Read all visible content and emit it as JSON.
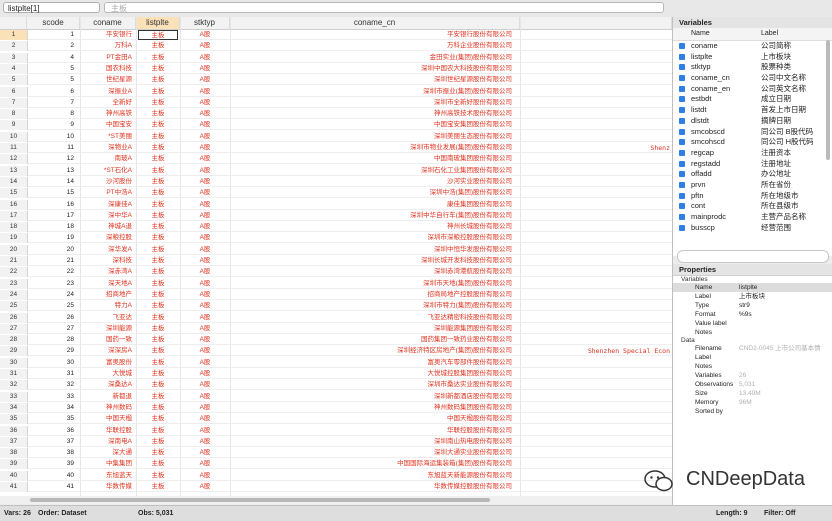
{
  "toolbar": {
    "cell_ref": "listplte[1]",
    "cell_value": "主板"
  },
  "columns": [
    "scode",
    "coname",
    "listplte",
    "stktyp",
    "coname_cn"
  ],
  "rows": [
    {
      "n": "1",
      "scode": "1",
      "coname": "平安银行",
      "listplte": "主板",
      "stktyp": "A股",
      "coname_cn": "平安银行股份有限公司",
      "coname_en": ""
    },
    {
      "n": "2",
      "scode": "2",
      "coname": "万科A",
      "listplte": "主板",
      "stktyp": "A股",
      "coname_cn": "万科企业股份有限公司",
      "coname_en": ""
    },
    {
      "n": "3",
      "scode": "4",
      "coname": "PT金田A",
      "listplte": "主板",
      "stktyp": "A股",
      "coname_cn": "金田实业(集团)股份有限公司",
      "coname_en": ""
    },
    {
      "n": "4",
      "scode": "5",
      "coname": "国农科技",
      "listplte": "主板",
      "stktyp": "A股",
      "coname_cn": "深圳中国农大科技股份有限公司",
      "coname_en": ""
    },
    {
      "n": "5",
      "scode": "5",
      "coname": "世纪星源",
      "listplte": "主板",
      "stktyp": "A股",
      "coname_cn": "深圳世纪星源股份有限公司",
      "coname_en": ""
    },
    {
      "n": "6",
      "scode": "6",
      "coname": "深振业A",
      "listplte": "主板",
      "stktyp": "A股",
      "coname_cn": "深圳市振业(集团)股份有限公司",
      "coname_en": ""
    },
    {
      "n": "7",
      "scode": "7",
      "coname": "全新好",
      "listplte": "主板",
      "stktyp": "A股",
      "coname_cn": "深圳市全新好股份有限公司",
      "coname_en": ""
    },
    {
      "n": "8",
      "scode": "8",
      "coname": "神州高铁",
      "listplte": "主板",
      "stktyp": "A股",
      "coname_cn": "神州高铁技术股份有限公司",
      "coname_en": ""
    },
    {
      "n": "9",
      "scode": "9",
      "coname": "中国宝安",
      "listplte": "主板",
      "stktyp": "A股",
      "coname_cn": "中国宝安集团股份有限公司",
      "coname_en": ""
    },
    {
      "n": "10",
      "scode": "10",
      "coname": "*ST美丽",
      "listplte": "主板",
      "stktyp": "A股",
      "coname_cn": "深圳美丽生态股份有限公司",
      "coname_en": ""
    },
    {
      "n": "11",
      "scode": "11",
      "coname": "深物业A",
      "listplte": "主板",
      "stktyp": "A股",
      "coname_cn": "深圳市物业发展(集团)股份有限公司",
      "coname_en": "Shenz"
    },
    {
      "n": "12",
      "scode": "12",
      "coname": "南玻A",
      "listplte": "主板",
      "stktyp": "A股",
      "coname_cn": "中国南玻集团股份有限公司",
      "coname_en": ""
    },
    {
      "n": "13",
      "scode": "13",
      "coname": "*ST石化A",
      "listplte": "主板",
      "stktyp": "A股",
      "coname_cn": "深圳石化工业集团股份有限公司",
      "coname_en": ""
    },
    {
      "n": "14",
      "scode": "14",
      "coname": "沙河股份",
      "listplte": "主板",
      "stktyp": "A股",
      "coname_cn": "沙河实业股份有限公司",
      "coname_en": ""
    },
    {
      "n": "15",
      "scode": "15",
      "coname": "PT中浩A",
      "listplte": "主板",
      "stktyp": "A股",
      "coname_cn": "深圳中浩(集团)股份有限公司",
      "coname_en": ""
    },
    {
      "n": "16",
      "scode": "16",
      "coname": "深康佳A",
      "listplte": "主板",
      "stktyp": "A股",
      "coname_cn": "康佳集团股份有限公司",
      "coname_en": ""
    },
    {
      "n": "17",
      "scode": "17",
      "coname": "深中华A",
      "listplte": "主板",
      "stktyp": "A股",
      "coname_cn": "深圳中华自行车(集团)股份有限公司",
      "coname_en": ""
    },
    {
      "n": "18",
      "scode": "18",
      "coname": "神城A退",
      "listplte": "主板",
      "stktyp": "A股",
      "coname_cn": "神州长城股份有限公司",
      "coname_en": ""
    },
    {
      "n": "19",
      "scode": "19",
      "coname": "深粮控股",
      "listplte": "主板",
      "stktyp": "A股",
      "coname_cn": "深圳市深粮控股股份有限公司",
      "coname_en": ""
    },
    {
      "n": "20",
      "scode": "20",
      "coname": "深华发A",
      "listplte": "主板",
      "stktyp": "A股",
      "coname_cn": "深圳中恒华发股份有限公司",
      "coname_en": ""
    },
    {
      "n": "21",
      "scode": "21",
      "coname": "深科技",
      "listplte": "主板",
      "stktyp": "A股",
      "coname_cn": "深圳长城开发科技股份有限公司",
      "coname_en": ""
    },
    {
      "n": "22",
      "scode": "22",
      "coname": "深赤湾A",
      "listplte": "主板",
      "stktyp": "A股",
      "coname_cn": "深圳赤湾港航股份有限公司",
      "coname_en": ""
    },
    {
      "n": "23",
      "scode": "23",
      "coname": "深天地A",
      "listplte": "主板",
      "stktyp": "A股",
      "coname_cn": "深圳市天地(集团)股份有限公司",
      "coname_en": ""
    },
    {
      "n": "24",
      "scode": "24",
      "coname": "招商地产",
      "listplte": "主板",
      "stktyp": "A股",
      "coname_cn": "招商局地产控股股份有限公司",
      "coname_en": ""
    },
    {
      "n": "25",
      "scode": "25",
      "coname": "特力A",
      "listplte": "主板",
      "stktyp": "A股",
      "coname_cn": "深圳市特力(集团)股份有限公司",
      "coname_en": ""
    },
    {
      "n": "26",
      "scode": "26",
      "coname": "飞亚达",
      "listplte": "主板",
      "stktyp": "A股",
      "coname_cn": "飞亚达精密科技股份有限公司",
      "coname_en": ""
    },
    {
      "n": "27",
      "scode": "27",
      "coname": "深圳能源",
      "listplte": "主板",
      "stktyp": "A股",
      "coname_cn": "深圳能源集团股份有限公司",
      "coname_en": ""
    },
    {
      "n": "28",
      "scode": "28",
      "coname": "国药一致",
      "listplte": "主板",
      "stktyp": "A股",
      "coname_cn": "国药集团一致药业股份有限公司",
      "coname_en": ""
    },
    {
      "n": "29",
      "scode": "29",
      "coname": "深深房A",
      "listplte": "主板",
      "stktyp": "A股",
      "coname_cn": "深圳经济特区房地产(集团)股份有限公司",
      "coname_en": "Shenzhen Special Econ"
    },
    {
      "n": "30",
      "scode": "30",
      "coname": "富奥股份",
      "listplte": "主板",
      "stktyp": "A股",
      "coname_cn": "富奥汽车零部件股份有限公司",
      "coname_en": ""
    },
    {
      "n": "31",
      "scode": "31",
      "coname": "大悦城",
      "listplte": "主板",
      "stktyp": "A股",
      "coname_cn": "大悦城控股集团股份有限公司",
      "coname_en": ""
    },
    {
      "n": "32",
      "scode": "32",
      "coname": "深桑达A",
      "listplte": "主板",
      "stktyp": "A股",
      "coname_cn": "深圳市桑达实业股份有限公司",
      "coname_en": ""
    },
    {
      "n": "33",
      "scode": "33",
      "coname": "新都退",
      "listplte": "主板",
      "stktyp": "A股",
      "coname_cn": "深圳新都酒店股份有限公司",
      "coname_en": ""
    },
    {
      "n": "34",
      "scode": "34",
      "coname": "神州数码",
      "listplte": "主板",
      "stktyp": "A股",
      "coname_cn": "神州数码集团股份有限公司",
      "coname_en": ""
    },
    {
      "n": "35",
      "scode": "35",
      "coname": "中国天楹",
      "listplte": "主板",
      "stktyp": "A股",
      "coname_cn": "中国天楹股份有限公司",
      "coname_en": ""
    },
    {
      "n": "36",
      "scode": "36",
      "coname": "华联控股",
      "listplte": "主板",
      "stktyp": "A股",
      "coname_cn": "华联控股股份有限公司",
      "coname_en": ""
    },
    {
      "n": "37",
      "scode": "37",
      "coname": "深南电A",
      "listplte": "主板",
      "stktyp": "A股",
      "coname_cn": "深圳南山热电股份有限公司",
      "coname_en": ""
    },
    {
      "n": "38",
      "scode": "38",
      "coname": "深大通",
      "listplte": "主板",
      "stktyp": "A股",
      "coname_cn": "深圳大通实业股份有限公司",
      "coname_en": ""
    },
    {
      "n": "39",
      "scode": "39",
      "coname": "中集集团",
      "listplte": "主板",
      "stktyp": "A股",
      "coname_cn": "中国国际海运集装箱(集团)股份有限公司",
      "coname_en": ""
    },
    {
      "n": "40",
      "scode": "40",
      "coname": "东旭蓝天",
      "listplte": "主板",
      "stktyp": "A股",
      "coname_cn": "东旭蓝天新能源股份有限公司",
      "coname_en": ""
    },
    {
      "n": "41",
      "scode": "41",
      "coname": "华数传媒",
      "listplte": "主板",
      "stktyp": "A股",
      "coname_cn": "华数传媒控股股份有限公司",
      "coname_en": ""
    }
  ],
  "variables_panel": {
    "title": "Variables",
    "col_name": "Name",
    "col_label": "Label",
    "items": [
      {
        "name": "coname",
        "label": "公司简称"
      },
      {
        "name": "listplte",
        "label": "上市板块"
      },
      {
        "name": "stktyp",
        "label": "股票种类"
      },
      {
        "name": "coname_cn",
        "label": "公司中文名称"
      },
      {
        "name": "coname_en",
        "label": "公司英文名称"
      },
      {
        "name": "estbdt",
        "label": "成立日期"
      },
      {
        "name": "listdt",
        "label": "首发上市日期"
      },
      {
        "name": "dlstdt",
        "label": "摘牌日期"
      },
      {
        "name": "smcobscd",
        "label": "同公司 B股代码"
      },
      {
        "name": "smcohscd",
        "label": "同公司 H股代码"
      },
      {
        "name": "regcap",
        "label": "注册资本"
      },
      {
        "name": "regstadd",
        "label": "注册地址"
      },
      {
        "name": "offadd",
        "label": "办公地址"
      },
      {
        "name": "prvn",
        "label": "所在省份"
      },
      {
        "name": "pftn",
        "label": "所在地级市"
      },
      {
        "name": "cont",
        "label": "所在县级市"
      },
      {
        "name": "mainprodc",
        "label": "主营产品名称"
      },
      {
        "name": "busscp",
        "label": "经营范围"
      }
    ]
  },
  "properties_panel": {
    "title": "Properties",
    "group_variables": "Variables",
    "group_data": "Data",
    "var_props": [
      {
        "k": "Name",
        "v": "listplte"
      },
      {
        "k": "Label",
        "v": "上市板块"
      },
      {
        "k": "Type",
        "v": "str9"
      },
      {
        "k": "Format",
        "v": "%9s"
      },
      {
        "k": "Value label",
        "v": ""
      },
      {
        "k": "Notes",
        "v": ""
      }
    ],
    "data_props": [
      {
        "k": "Filename",
        "v": "CND2-0045 上市公司基本情"
      },
      {
        "k": "Label",
        "v": ""
      },
      {
        "k": "Notes",
        "v": ""
      },
      {
        "k": "Variables",
        "v": "26"
      },
      {
        "k": "Observations",
        "v": "5,031"
      },
      {
        "k": "Size",
        "v": "13.49M"
      },
      {
        "k": "Memory",
        "v": "96M"
      },
      {
        "k": "Sorted by",
        "v": ""
      }
    ]
  },
  "status": {
    "vars": "Vars: 26",
    "order": "Order: Dataset",
    "obs": "Obs: 5,031",
    "length": "Length: 9",
    "filter": "Filter: Off"
  },
  "watermark": "CNDeepData",
  "colors": {
    "data_text": "#e0321e",
    "selected_header": "#fbe1b8",
    "checkbox": "#2f7fe6"
  }
}
